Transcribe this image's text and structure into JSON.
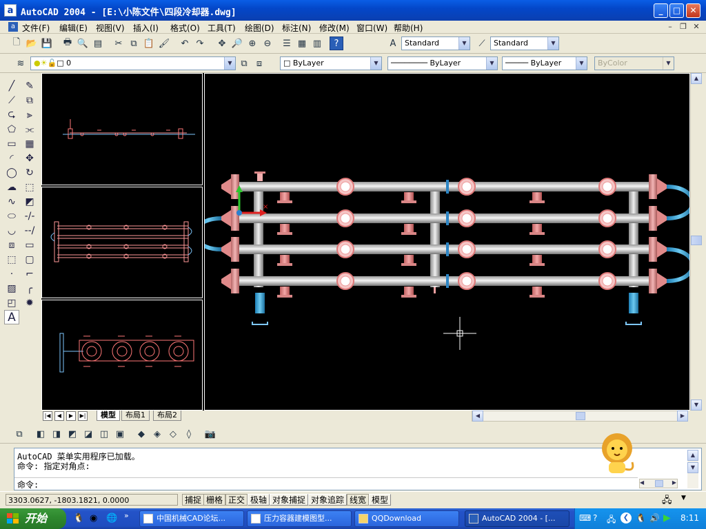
{
  "window": {
    "app_icon": "a",
    "title": "AutoCAD 2004 - [E:\\小陈文件\\四段冷却器.dwg]",
    "controls": [
      "minimize-icon",
      "maximize-icon",
      "close-icon"
    ]
  },
  "menubar": {
    "items": [
      "文件(F)",
      "编辑(E)",
      "视图(V)",
      "插入(I)",
      "格式(O)",
      "工具(T)",
      "绘图(D)",
      "标注(N)",
      "修改(M)",
      "窗口(W)",
      "帮助(H)"
    ]
  },
  "styles_toolbar": {
    "text_style": "Standard",
    "dim_style": "Standard"
  },
  "layer_toolbar": {
    "layer_name": "0",
    "color": "ByLayer",
    "linetype": "ByLayer",
    "lineweight": "ByLayer",
    "plot_style": "ByColor"
  },
  "layout_tabs": {
    "tabs": [
      "模型",
      "布局1",
      "布局2"
    ],
    "active": "模型"
  },
  "command_window": {
    "lines": [
      "AutoCAD 菜单实用程序已加载。",
      "命令: 指定对角点:"
    ],
    "prompt": "命令:"
  },
  "statusbar": {
    "coordinates": "3303.0627, -1803.1821, 0.0000",
    "toggles": [
      {
        "label": "捕捉",
        "on": false
      },
      {
        "label": "栅格",
        "on": false
      },
      {
        "label": "正交",
        "on": false
      },
      {
        "label": "极轴",
        "on": true
      },
      {
        "label": "对象捕捉",
        "on": true
      },
      {
        "label": "对象追踪",
        "on": true
      },
      {
        "label": "线宽",
        "on": false
      },
      {
        "label": "模型",
        "on": true
      }
    ]
  },
  "taskbar": {
    "start_label": "开始",
    "items": [
      {
        "label": "中国机械CAD论坛...",
        "active": false
      },
      {
        "label": "压力容器建模图型...",
        "active": false
      },
      {
        "label": "QQDownload",
        "active": false
      },
      {
        "label": "AutoCAD 2004 - [...",
        "active": true
      }
    ],
    "clock": "8:11"
  },
  "colors": {
    "titlebar": "#0a5ee6",
    "canvas": "#000000",
    "pipe": "#d9d9d9",
    "flange": "#e8a2a2",
    "nozzle": "#e07070",
    "u_bend": "#4fb3e0",
    "support": "#3aa0d8"
  }
}
